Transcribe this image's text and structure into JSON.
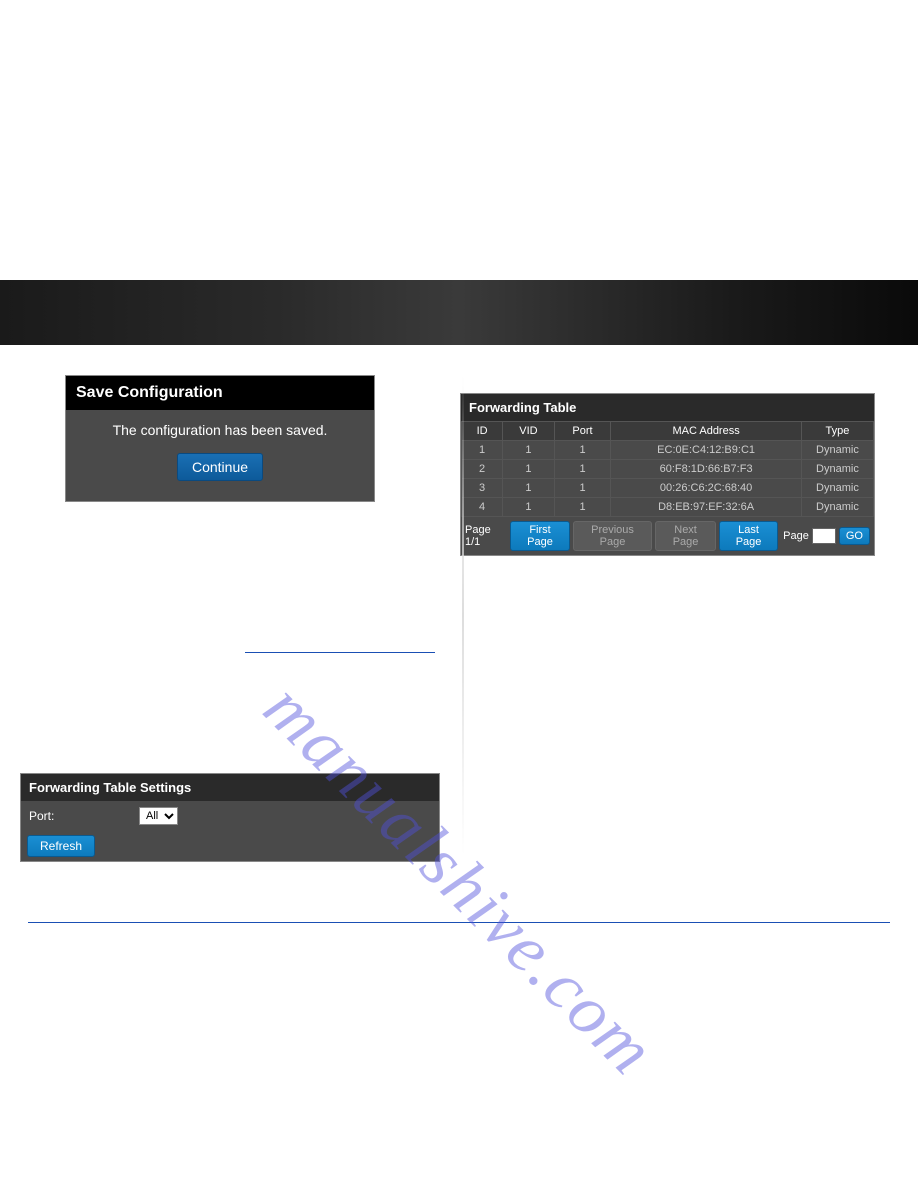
{
  "save_config": {
    "title": "Save Configuration",
    "message": "The configuration has been saved.",
    "continue_label": "Continue"
  },
  "fwd_settings": {
    "title": "Forwarding Table Settings",
    "port_label": "Port:",
    "port_value": "All",
    "refresh_label": "Refresh"
  },
  "fwd_table": {
    "title": "Forwarding Table",
    "headers": {
      "id": "ID",
      "vid": "VID",
      "port": "Port",
      "mac": "MAC Address",
      "type": "Type"
    },
    "rows": [
      {
        "id": "1",
        "vid": "1",
        "port": "1",
        "mac": "EC:0E:C4:12:B9:C1",
        "type": "Dynamic"
      },
      {
        "id": "2",
        "vid": "1",
        "port": "1",
        "mac": "60:F8:1D:66:B7:F3",
        "type": "Dynamic"
      },
      {
        "id": "3",
        "vid": "1",
        "port": "1",
        "mac": "00:26:C6:2C:68:40",
        "type": "Dynamic"
      },
      {
        "id": "4",
        "vid": "1",
        "port": "1",
        "mac": "D8:EB:97:EF:32:6A",
        "type": "Dynamic"
      }
    ],
    "pagination": {
      "page_info": "Page 1/1",
      "first_label": "First Page",
      "prev_label": "Previous Page",
      "next_label": "Next Page",
      "last_label": "Last Page",
      "page_label": "Page",
      "go_label": "GO"
    }
  },
  "watermark": "manualshive.com"
}
